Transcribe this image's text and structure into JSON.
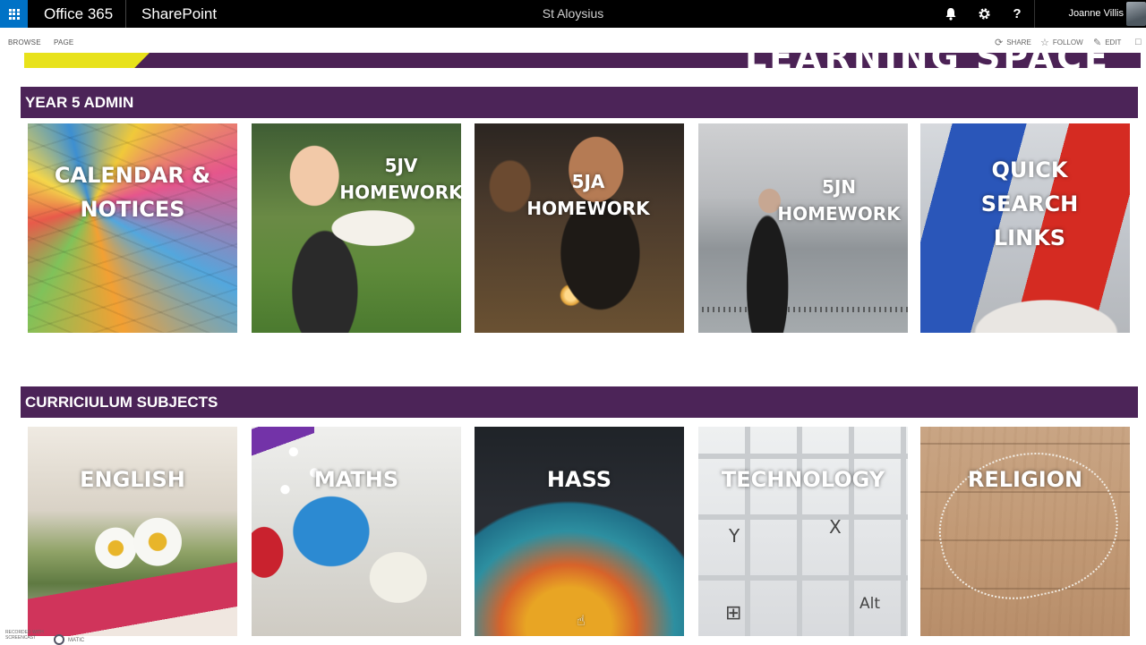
{
  "suite_bar": {
    "app_name": "Office 365",
    "product": "SharePoint",
    "site_title": "St Aloysius",
    "user_name": "Joanne Villis",
    "icons": [
      "waffle-icon",
      "bell-icon",
      "gear-icon",
      "help-icon"
    ],
    "accent_color": "#0072c6"
  },
  "ribbon": {
    "tabs": [
      "BROWSE",
      "PAGE"
    ],
    "actions": {
      "share": "SHARE",
      "follow": "FOLLOW",
      "edit": "EDIT"
    }
  },
  "sections": [
    {
      "title": "YEAR 5 ADMIN",
      "tiles": [
        {
          "label": "CALENDAR &\nNOTICES",
          "image": "sticky-notes"
        },
        {
          "label": "5JV\nHOMEWORK",
          "image": "girl-with-bird"
        },
        {
          "label": "5JA\nHOMEWORK",
          "image": "girl-with-candle"
        },
        {
          "label": "5JN\nHOMEWORK",
          "image": "golden-gate-bridge"
        },
        {
          "label": "QUICK\nSEARCH\nLINKS",
          "image": "shovels-in-snow"
        }
      ]
    },
    {
      "title": "CURRICIULUM SUBJECTS",
      "tiles": [
        {
          "label": "ENGLISH",
          "image": "book-and-daisies"
        },
        {
          "label": "MATHS",
          "image": "dice"
        },
        {
          "label": "HASS",
          "image": "globe"
        },
        {
          "label": "TECHNOLOGY",
          "image": "keyboard"
        },
        {
          "label": "RELIGION",
          "image": "rosary-on-wood"
        }
      ]
    }
  ],
  "banner_text": "LEARNING SPACE",
  "section_color": "#4c2458",
  "keyboard_keys": [
    "Y",
    "X",
    "Alt"
  ],
  "watermark": {
    "line1": "RECORDED WITH",
    "line2": "SCREENCAST",
    "line3": "MATIC"
  }
}
